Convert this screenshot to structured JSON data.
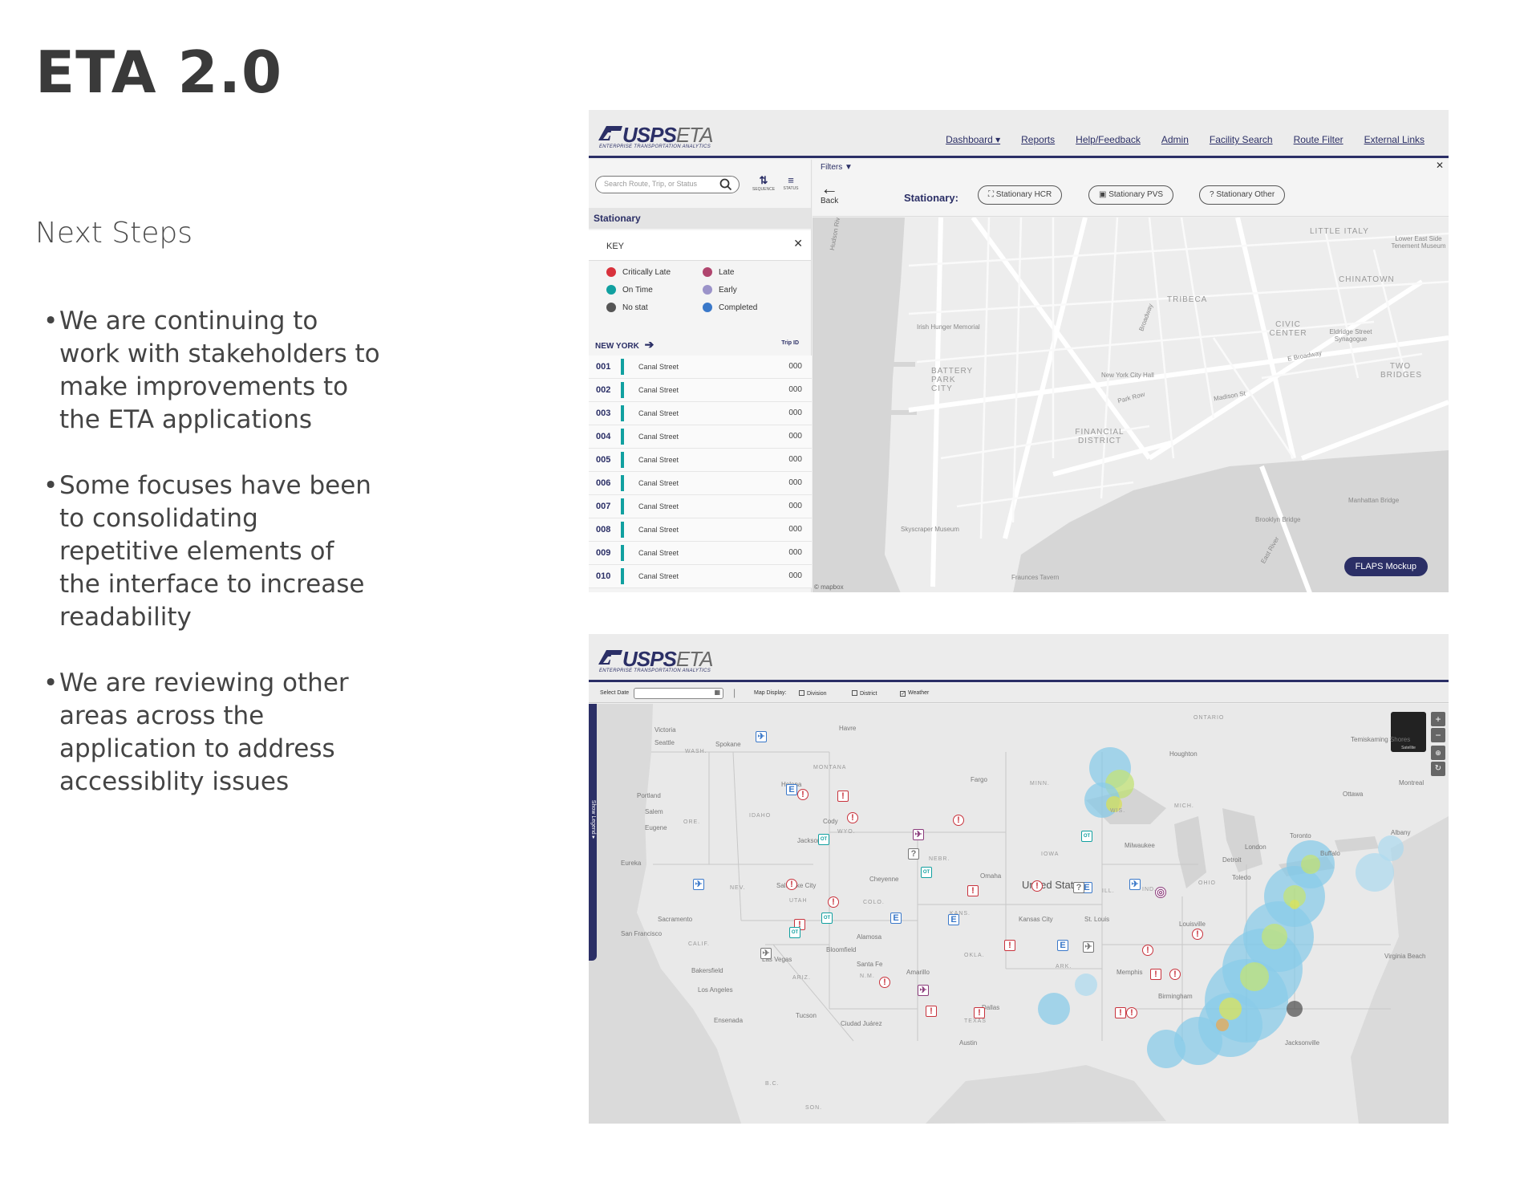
{
  "slide": {
    "title": "ETA 2.0",
    "section": "Next Steps",
    "bullets": [
      "We are continuing to work with stakeholders to make improvements to the ETA applications",
      "Some focuses have been to consolidating repetitive elements of the interface to  increase readability",
      "We are reviewing other areas across the application to address accessiblity issues"
    ]
  },
  "app": {
    "logo_main": "USPS",
    "logo_eta": "ETA",
    "logo_sub": "ENTERPRISE TRANSPORTATION ANALYTICS",
    "brand_color": "#2b2f66"
  },
  "shot1": {
    "nav": [
      "Dashboard ▾",
      "Reports",
      "Help/Feedback",
      "Admin",
      "Facility Search",
      "Route Filter",
      "External Links"
    ],
    "search_placeholder": "Search Route, Trip, or Status",
    "sort_sequence": "SEQUENCE",
    "sort_status": "STATUS",
    "section": "Stationary",
    "key_title": "KEY",
    "legend": [
      {
        "label": "Critically Late",
        "color": "#d8323c"
      },
      {
        "label": "Late",
        "color": "#b0456e"
      },
      {
        "label": "On Time",
        "color": "#11a0a0"
      },
      {
        "label": "Early",
        "color": "#9b93c9"
      },
      {
        "label": "No stat",
        "color": "#555555"
      },
      {
        "label": "Completed",
        "color": "#3a78c9"
      }
    ],
    "region": "NEW YORK",
    "trip_id_label": "Trip ID",
    "trips": [
      {
        "num": "001",
        "name": "Canal Street",
        "id": "000"
      },
      {
        "num": "002",
        "name": "Canal Street",
        "id": "000"
      },
      {
        "num": "003",
        "name": "Canal Street",
        "id": "000"
      },
      {
        "num": "004",
        "name": "Canal Street",
        "id": "000"
      },
      {
        "num": "005",
        "name": "Canal Street",
        "id": "000"
      },
      {
        "num": "006",
        "name": "Canal Street",
        "id": "000"
      },
      {
        "num": "007",
        "name": "Canal Street",
        "id": "000"
      },
      {
        "num": "008",
        "name": "Canal Street",
        "id": "000"
      },
      {
        "num": "009",
        "name": "Canal Street",
        "id": "000"
      },
      {
        "num": "010",
        "name": "Canal Street",
        "id": "000"
      }
    ],
    "filters_label": "Filters",
    "back_label": "Back",
    "stationary_label": "Stationary:",
    "chips": [
      "Stationary HCR",
      "Stationary PVS",
      "Stationary Other"
    ],
    "map_labels": {
      "little_italy": "LITTLE ITALY",
      "chinatown": "CHINATOWN",
      "tribeca": "TRIBECA",
      "civic_center": "CIVIC CENTER",
      "battery_park": "BATTERY PARK CITY",
      "financial": "FINANCIAL DISTRICT",
      "two_bridges": "TWO BRIDGES",
      "irish": "Irish Hunger Memorial",
      "nych": "New York City Hall",
      "skyscraper": "Skyscraper Museum",
      "hudson": "Hudson River",
      "broadway": "Broadway",
      "park_row": "Park Row",
      "madison": "Madison St",
      "e_broadway": "E Broadway",
      "eldridge": "Eldridge Street Synagogue",
      "les": "Lower East Side Tenement Museum",
      "manhattan_bridge": "Manhattan Bridge",
      "brooklyn_bridge": "Brooklyn Bridge",
      "east_river": "East River",
      "fraunces": "Fraunces Tavern",
      "mapbox": "© mapbox"
    },
    "flaps_button": "FLAPS Mockup"
  },
  "shot2": {
    "select_date": "Select Date",
    "map_display": "Map Display:",
    "division": "Division",
    "district": "District",
    "weather": "Weather",
    "show_legend": "Show Legend ▸",
    "satellite": "Satellite",
    "us_label": "United States",
    "cities": {
      "seattle": "Seattle",
      "portland": "Portland",
      "salem": "Salem",
      "eugene": "Eugene",
      "sacramento": "Sacramento",
      "sf": "San Francisco",
      "las_vegas": "Las Vegas",
      "bakersfield": "Bakersfield",
      "la": "Los Angeles",
      "ensenada": "Ensenada",
      "helena": "Helena",
      "cody": "Cody",
      "jackson": "Jackson",
      "slc": "Salt Lake City",
      "cheyenne": "Cheyenne",
      "alamosa": "Alamosa",
      "bloomfield": "Bloomfield",
      "santa_fe": "Santa Fe",
      "tucson": "Tucson",
      "juarez": "Ciudad Juárez",
      "amarillo": "Amarillo",
      "fargo": "Fargo",
      "omaha": "Omaha",
      "kc": "Kansas City",
      "st_louis": "St. Louis",
      "dallas": "Dallas",
      "austin": "Austin",
      "memphis": "Memphis",
      "birmingham": "Birmingham",
      "milwaukee": "Milwaukee",
      "detroit": "Detroit",
      "toledo": "Toledo",
      "louisville": "Louisville",
      "london": "London",
      "toronto": "Toronto",
      "buffalo": "Buffalo",
      "ottawa": "Ottawa",
      "montreal": "Montreal",
      "jacksonville": "Jacksonville",
      "virginia_beach": "Virginia Beach",
      "spokane": "Spokane",
      "victoria": "Victoria",
      "havre": "Havre",
      "houghton": "Houghton",
      "temiskaming": "Temiskaming Shores",
      "eureka": "Eureka",
      "albany": "Albany"
    },
    "states": {
      "wash": "WASH.",
      "ore": "ORE.",
      "idaho": "IDAHO",
      "montana": "MONTANA",
      "wyo": "WYO.",
      "nev": "NEV.",
      "utah": "UTAH",
      "colo": "COLO.",
      "calif": "CALIF.",
      "ariz": "ARIZ.",
      "nm": "N.M.",
      "nebr": "NEBR.",
      "kans": "KANS.",
      "okla": "OKLA.",
      "texas": "TEXAS",
      "iowa": "IOWA",
      "minn": "MINN.",
      "wis": "WIS.",
      "mich": "MICH.",
      "ill": "ILL.",
      "ind": "IND.",
      "ohio": "OHIO",
      "ark": "ARK.",
      "ontario": "ONTARIO",
      "bc": "B.C.",
      "son": "SON."
    }
  }
}
